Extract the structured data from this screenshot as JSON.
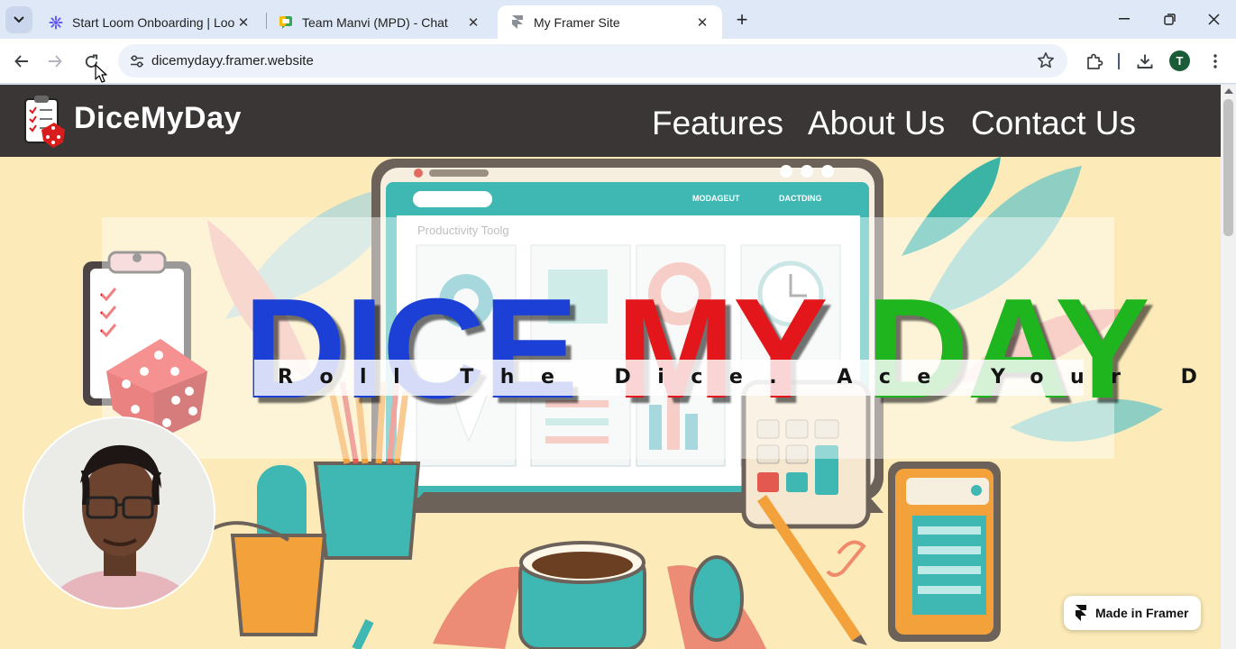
{
  "browser": {
    "tabs": [
      {
        "title": "Start Loom Onboarding | Loom",
        "icon": "loom-icon",
        "active": false
      },
      {
        "title": "Team Manvi (MPD) - Chat",
        "icon": "google-chat-icon",
        "active": false
      },
      {
        "title": "My Framer Site",
        "icon": "framer-icon",
        "active": true
      }
    ],
    "close_glyph": "✕",
    "new_tab_glyph": "+",
    "url": "dicemydayy.framer.website",
    "profile_initial": "T",
    "accent": "#dfe8f7"
  },
  "site": {
    "brand": "DiceMyDay",
    "nav": [
      "Features",
      "About Us",
      "Contact Us"
    ],
    "hero": {
      "title_words": [
        "DICE",
        "MY",
        "DAY"
      ],
      "title_colors": [
        "#1c3fd6",
        "#e3171b",
        "#1eb51e"
      ],
      "tagline": "Roll The Dice. Ace Your Day!",
      "illustration_labels": [
        "Productivity Toolg",
        "MODAGEUT",
        "DACTDING"
      ]
    },
    "badge": "Made in Framer",
    "header_color": "#3a3636",
    "hero_bg": "#fcebb8"
  }
}
